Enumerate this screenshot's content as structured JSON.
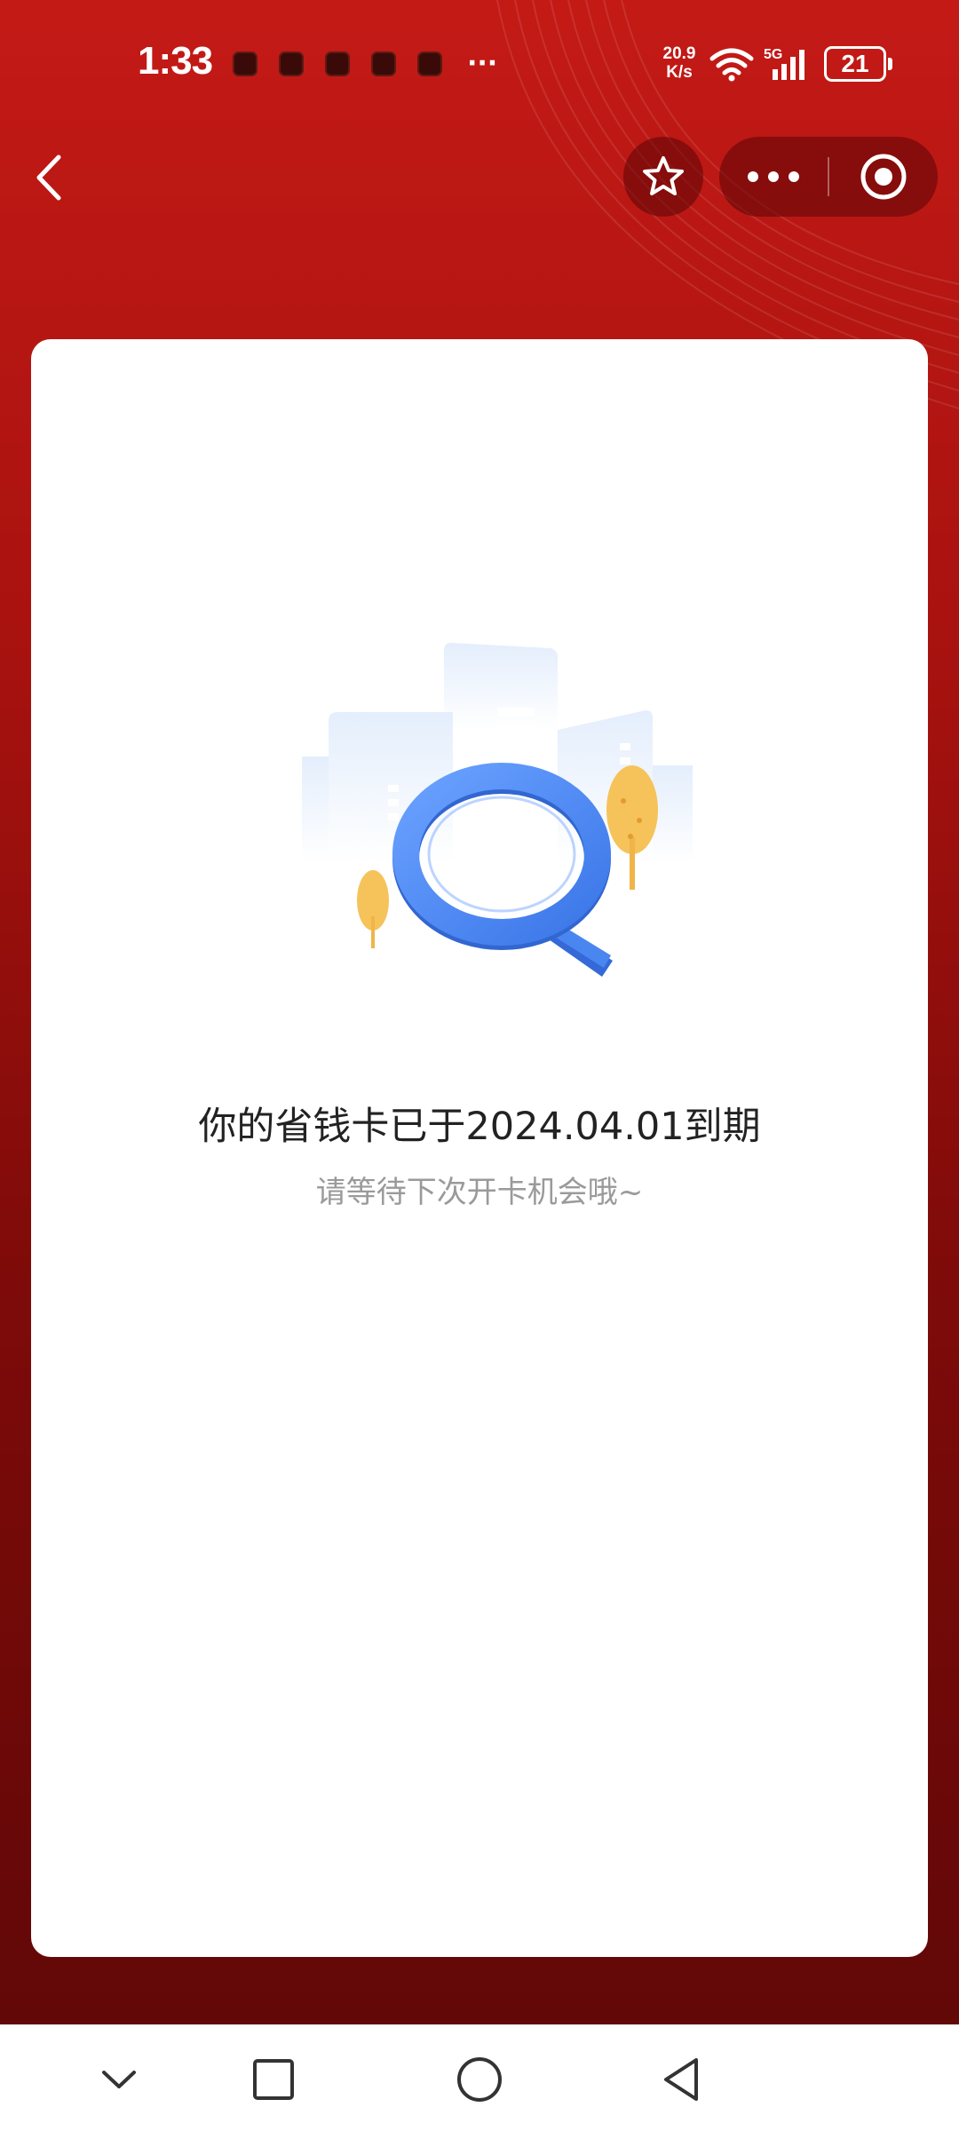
{
  "status_bar": {
    "time": "1:33",
    "net_speed_value": "20.9",
    "net_speed_unit": "K/s",
    "signal_label": "5G",
    "battery": "21"
  },
  "page": {
    "title": "",
    "expired_message": "你的省钱卡已于2024.04.01到期",
    "hint": "请等待下次开卡机会哦~"
  },
  "colors": {
    "background_top": "#c41a16",
    "background_bottom": "#5e0707",
    "illustration_blue": "#4a86f0",
    "tree_yellow": "#f5c35a"
  },
  "icons": {
    "back": "chevron-left-icon",
    "favorite": "star-icon",
    "more": "ellipsis-icon",
    "close": "target-icon",
    "nav_hide": "chevron-down-icon",
    "nav_recents": "square-icon",
    "nav_home": "circle-icon",
    "nav_back": "triangle-back-icon"
  }
}
